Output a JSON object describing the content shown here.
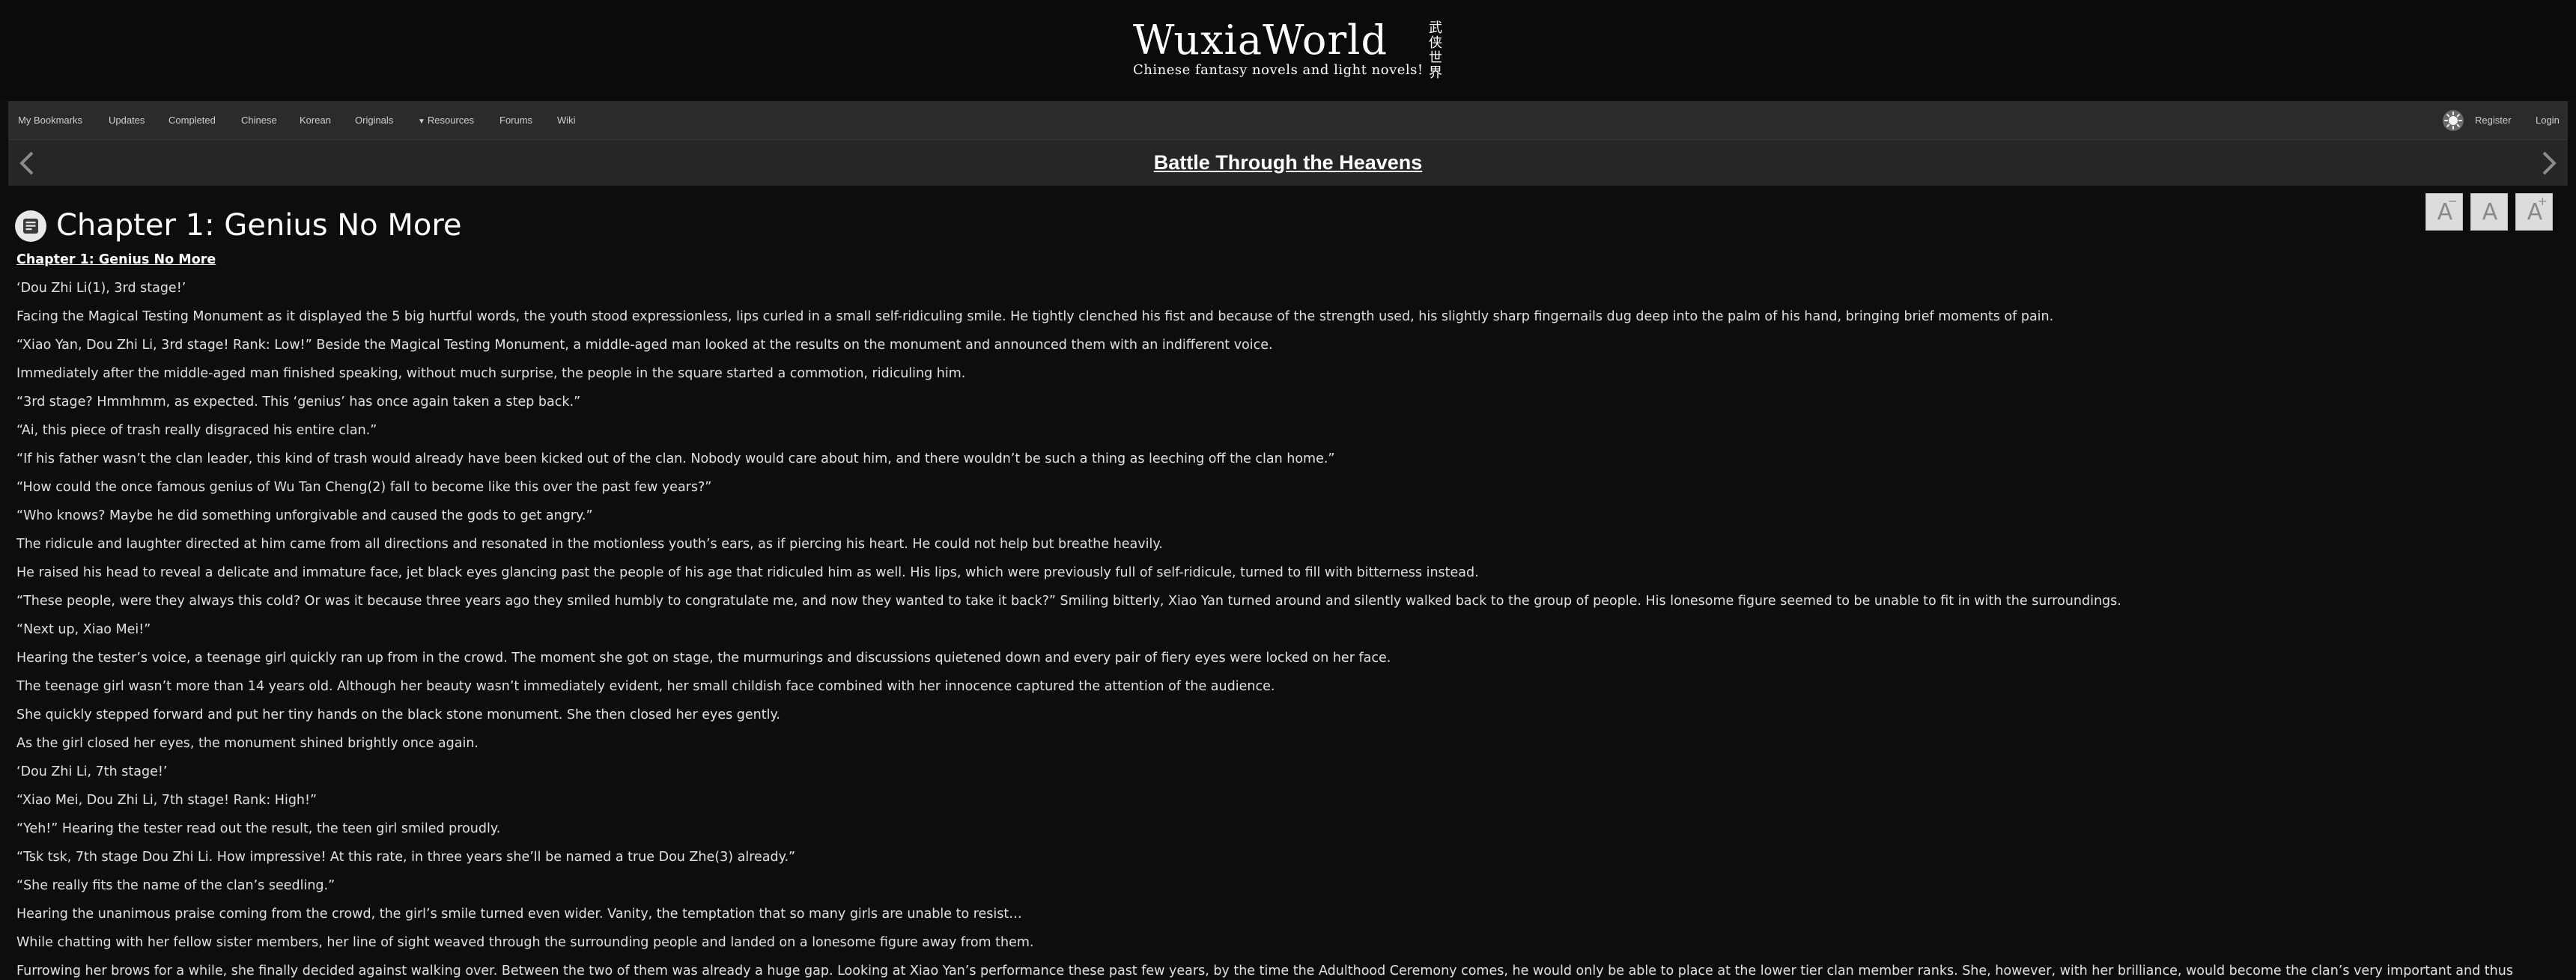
{
  "site": {
    "logo_main": "WuxiaWorld",
    "logo_sub": "Chinese fantasy novels and light novels!",
    "logo_cjk": "武侠世界"
  },
  "nav": {
    "my_bookmarks": "My Bookmarks",
    "updates": "Updates",
    "completed": "Completed",
    "chinese": "Chinese",
    "korean": "Korean",
    "originals": "Originals",
    "resources": "Resources",
    "forums": "Forums",
    "wiki": "Wiki",
    "register": "Register",
    "login": "Login"
  },
  "novel": {
    "title": "Battle Through the Heavens"
  },
  "chapter": {
    "title": "Chapter 1: Genius No More",
    "heading": "Chapter 1: Genius No More",
    "paragraphs": [
      "‘Dou Zhi Li(1), 3rd stage!’",
      "Facing the Magical Testing Monument as it displayed the 5 big hurtful words, the youth stood expressionless, lips curled in a small self-ridiculing smile. He tightly clenched his fist and because of the strength used, his slightly sharp fingernails dug deep into the palm of his hand, bringing brief moments of pain.",
      "“Xiao Yan, Dou Zhi Li, 3rd stage! Rank: Low!” Beside the Magical Testing Monument, a middle-aged man looked at the results on the monument and announced them with an indifferent voice.",
      "Immediately after the middle-aged man finished speaking, without much surprise, the people in the square started a commotion, ridiculing him.",
      "“3rd stage? Hmmhmm, as expected. This ‘genius’ has once again taken a step back.”",
      "“Ai, this piece of trash really disgraced his entire clan.”",
      "“If his father wasn’t the clan leader, this kind of trash would already have been kicked out of the clan. Nobody would care about him, and there wouldn’t be such a thing as leeching off the clan home.”",
      "“How could the once famous genius of Wu Tan Cheng(2) fall to become like this over the past few years?”",
      "“Who knows? Maybe he did something unforgivable and caused the gods to get angry.”",
      "The ridicule and laughter directed at him came from all directions and resonated in the motionless youth’s ears, as if piercing his heart. He could not help but breathe heavily.",
      "He raised his head to reveal a delicate and immature face, jet black eyes glancing past the people of his age that ridiculed him as well. His lips, which were previously full of self-ridicule, turned to fill with bitterness instead.",
      "“These people, were they always this cold? Or was it because three years ago they smiled humbly to congratulate me, and now they wanted to take it back?” Smiling bitterly, Xiao Yan turned around and silently walked back to the group of people. His lonesome figure seemed to be unable to fit in with the surroundings.",
      "“Next up, Xiao Mei!”",
      "Hearing the tester’s voice, a teenage girl quickly ran up from in the crowd. The moment she got on stage, the murmurings and discussions quietened down and every pair of fiery eyes were locked on her face.",
      "The teenage girl wasn’t more than 14 years old. Although her beauty wasn’t immediately evident, her small childish face combined with her innocence captured the attention of the audience.",
      "She quickly stepped forward and put her tiny hands on the black stone monument. She then closed her eyes gently.",
      "As the girl closed her eyes, the monument shined brightly once again.",
      "‘Dou Zhi Li, 7th stage!’",
      "“Xiao Mei, Dou Zhi Li, 7th stage! Rank: High!”",
      "“Yeh!” Hearing the tester read out the result, the teen girl smiled proudly.",
      "“Tsk tsk, 7th stage Dou Zhi Li. How impressive! At this rate, in three years she’ll be named a true Dou Zhe(3) already.”",
      "“She really fits the name of the clan’s seedling.”",
      "Hearing the unanimous praise coming from the crowd, the girl’s smile turned even wider. Vanity, the temptation that so many girls are unable to resist…",
      "While chatting with her fellow sister members, her line of sight weaved through the surrounding people and landed on a lonesome figure away from them.",
      "Furrowing her brows for a while, she finally decided against walking over. Between the two of them was already a huge gap. Looking at Xiao Yan’s performance these past few years, by the time the Adulthood Ceremony comes, he would only be able to place at the lower tier clan member ranks. She, however, with her brilliance, would become the clan’s very important and thus"
    ]
  },
  "font_controls": {
    "decrease_label": "A",
    "decrease_sign": "−",
    "reset_label": "A",
    "increase_label": "A",
    "increase_sign": "+"
  },
  "icons": {
    "prev": "chevron-left-icon",
    "next": "chevron-right-icon",
    "chapter": "document-icon",
    "theme": "sun-icon",
    "resources_caret": "chevron-down-icon"
  },
  "colors": {
    "background": "#0d0d0d",
    "navbar": "#2b2b2b",
    "titlebar": "#262626",
    "text": "#e0e0e0"
  }
}
